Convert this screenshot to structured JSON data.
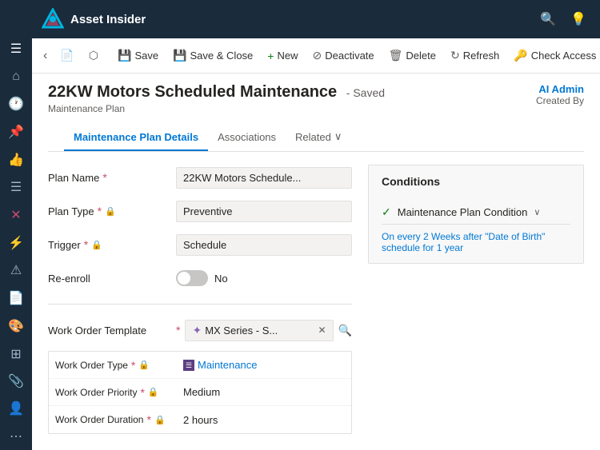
{
  "app": {
    "name": "Asset Insider"
  },
  "nav_icons": [
    "≡",
    "🏠",
    "🕐",
    "📌",
    "👍",
    "📋",
    "✕",
    "⚡",
    "⚠",
    "📄",
    "🎨",
    "🔲",
    "📎",
    "👤",
    "⋯"
  ],
  "command_bar": {
    "back_label": "‹",
    "save_label": "Save",
    "save_close_label": "Save & Close",
    "new_label": "New",
    "deactivate_label": "Deactivate",
    "delete_label": "Delete",
    "refresh_label": "Refresh",
    "check_access_label": "Check Access"
  },
  "entity": {
    "title": "22KW Motors Scheduled Maintenance",
    "saved_indicator": "- Saved",
    "subtitle": "Maintenance Plan",
    "admin_name": "AI Admin",
    "admin_label": "Created By"
  },
  "tabs": [
    {
      "id": "details",
      "label": "Maintenance Plan Details",
      "active": true
    },
    {
      "id": "associations",
      "label": "Associations"
    },
    {
      "id": "related",
      "label": "Related",
      "has_chevron": true
    }
  ],
  "form": {
    "plan_name_label": "Plan Name",
    "plan_name_value": "22KW Motors Schedule...",
    "plan_type_label": "Plan Type",
    "plan_type_value": "Preventive",
    "trigger_label": "Trigger",
    "trigger_value": "Schedule",
    "reenroll_label": "Re-enroll",
    "reenroll_value": "No",
    "work_order_template_label": "Work Order Template",
    "work_order_template_value": "MX Series - S...",
    "sub_fields": {
      "work_order_type_label": "Work Order Type",
      "work_order_type_value": "Maintenance",
      "work_order_priority_label": "Work Order Priority",
      "work_order_priority_value": "Medium",
      "work_order_duration_label": "Work Order Duration",
      "work_order_duration_value": "2 hours"
    }
  },
  "conditions": {
    "title": "Conditions",
    "item_label": "Maintenance Plan Condition",
    "description": "On every 2 Weeks after \"Date of Birth\" schedule for 1 year"
  }
}
